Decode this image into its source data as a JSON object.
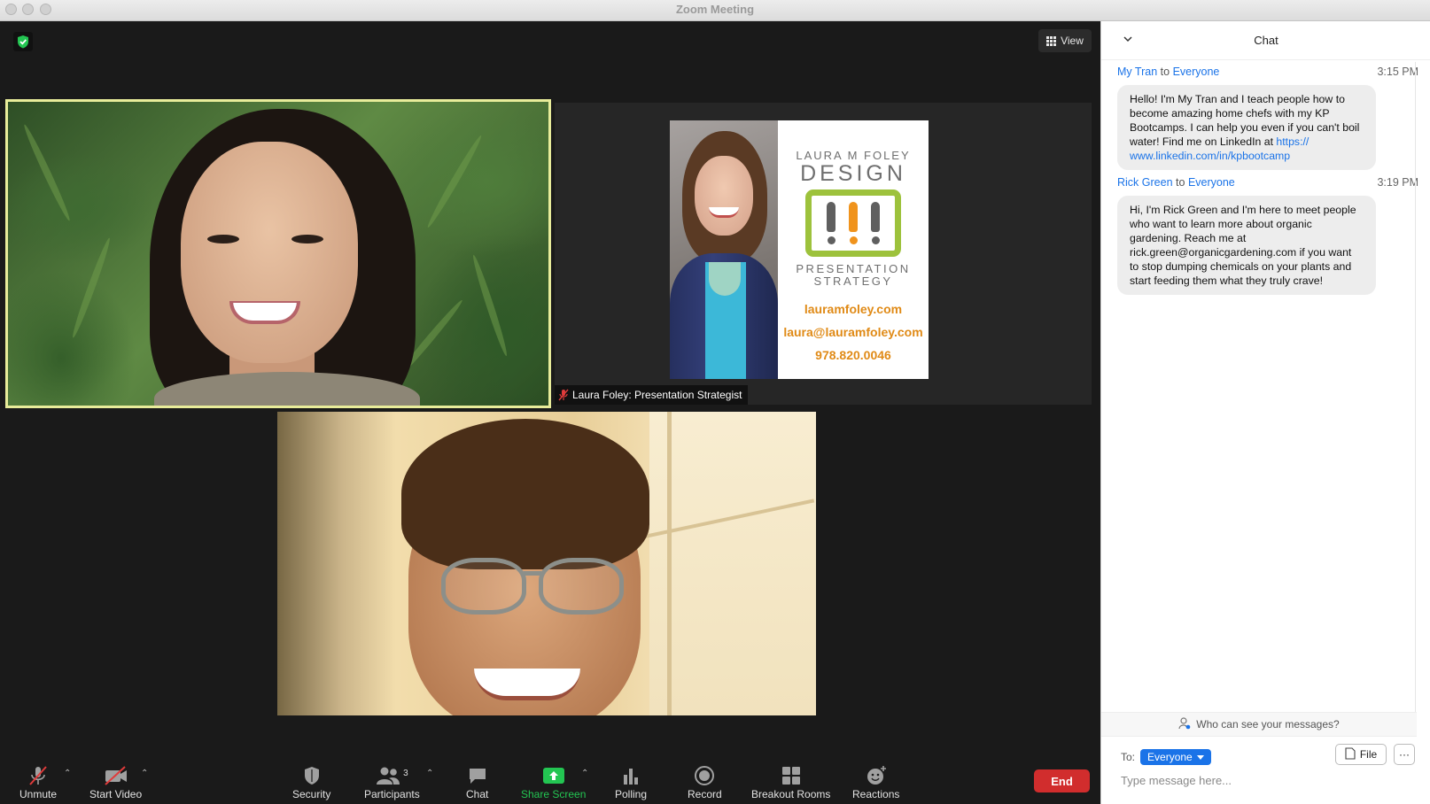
{
  "window": {
    "title": "Zoom Meeting"
  },
  "meeting": {
    "view_label": "View",
    "tiles": {
      "laura": {
        "name_tag": "Laura Foley: Presentation Strategist",
        "card": {
          "line1": "LAURA M FOLEY",
          "line2": "DESIGN",
          "line3": "PRESENTATION",
          "line4": "STRATEGY",
          "website": "lauramfoley.com",
          "email": "laura@lauramfoley.com",
          "phone": "978.820.0046"
        }
      }
    }
  },
  "toolbar": {
    "unmute": "Unmute",
    "start_video": "Start Video",
    "security": "Security",
    "participants": "Participants",
    "participants_count": "3",
    "chat": "Chat",
    "share_screen": "Share Screen",
    "polling": "Polling",
    "record": "Record",
    "breakout_rooms": "Breakout Rooms",
    "reactions": "Reactions",
    "end": "End"
  },
  "chat": {
    "title": "Chat",
    "messages": [
      {
        "sender": "My Tran",
        "to_word": "to",
        "recipient": "Everyone",
        "time": "3:15 PM",
        "text": "Hello! I'm My Tran and I teach people how to become amazing home chefs with my KP Bootcamps. I can help you even if you can't boil water! Find me on LinkedIn at ",
        "link": "https://\nwww.linkedin.com/in/kpbootcamp"
      },
      {
        "sender": "Rick Green",
        "to_word": "to",
        "recipient": "Everyone",
        "time": "3:19 PM",
        "text": "Hi, I'm Rick Green and I'm here to meet people who want to learn more about organic gardening. Reach me at rick.green@organicgardening.com if you want to stop dumping chemicals on your plants and start feeding them what they truly crave!"
      }
    ],
    "who_can_see": "Who can see your messages?",
    "to_label": "To:",
    "recipient_select": "Everyone",
    "file_label": "File",
    "more_label": "···",
    "input_placeholder": "Type message here..."
  },
  "colors": {
    "active_speaker_border": "#e8ec9a",
    "end_button": "#d12d2d",
    "share_screen": "#23c552",
    "link_blue": "#1a73e8",
    "logo_green": "#9dc23c",
    "logo_orange": "#f0931c",
    "logo_gray": "#5f5f5f"
  }
}
